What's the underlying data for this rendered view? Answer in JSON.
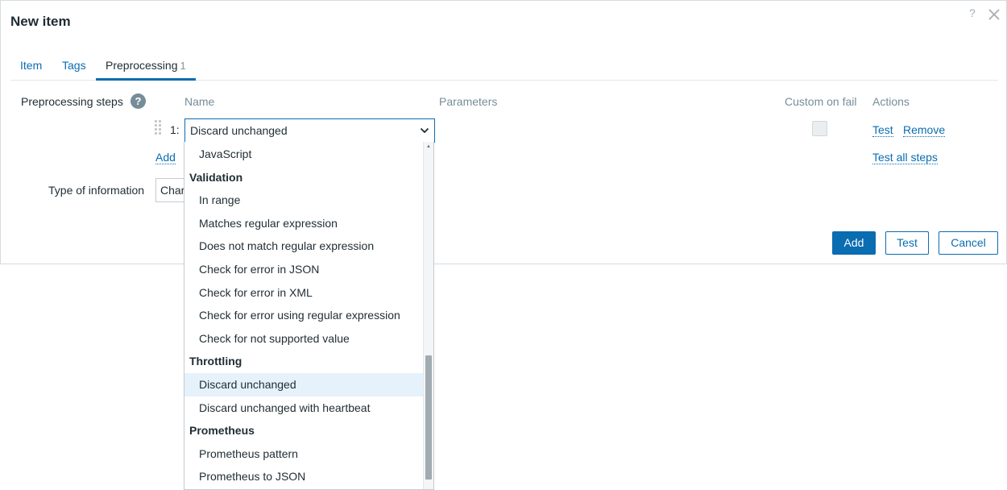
{
  "dialog": {
    "title": "New item",
    "help": "?",
    "tabs": [
      {
        "label": "Item"
      },
      {
        "label": "Tags"
      },
      {
        "label": "Preprocessing",
        "count": "1"
      }
    ]
  },
  "preprocessing": {
    "label": "Preprocessing steps",
    "help": "?",
    "columns": {
      "name": "Name",
      "parameters": "Parameters",
      "custom_on_fail": "Custom on fail",
      "actions": "Actions"
    },
    "step": {
      "number": "1:",
      "selected": "Discard unchanged",
      "custom_on_fail": false
    },
    "actions": {
      "test": "Test",
      "remove": "Remove",
      "test_all": "Test all steps",
      "add": "Add"
    }
  },
  "type_of_information": {
    "label": "Type of information",
    "value": "Character"
  },
  "buttons": {
    "add": "Add",
    "test": "Test",
    "cancel": "Cancel"
  },
  "dropdown": {
    "rows": [
      {
        "kind": "option",
        "label": "JavaScript"
      },
      {
        "kind": "group",
        "label": "Validation"
      },
      {
        "kind": "option",
        "label": "In range"
      },
      {
        "kind": "option",
        "label": "Matches regular expression"
      },
      {
        "kind": "option",
        "label": "Does not match regular expression"
      },
      {
        "kind": "option",
        "label": "Check for error in JSON"
      },
      {
        "kind": "option",
        "label": "Check for error in XML"
      },
      {
        "kind": "option",
        "label": "Check for error using regular expression"
      },
      {
        "kind": "option",
        "label": "Check for not supported value"
      },
      {
        "kind": "group",
        "label": "Throttling"
      },
      {
        "kind": "option",
        "label": "Discard unchanged",
        "selected": true
      },
      {
        "kind": "option",
        "label": "Discard unchanged with heartbeat"
      },
      {
        "kind": "group",
        "label": "Prometheus"
      },
      {
        "kind": "option",
        "label": "Prometheus pattern"
      },
      {
        "kind": "option",
        "label": "Prometheus to JSON"
      }
    ]
  },
  "colors": {
    "accent": "#0a6cb1",
    "selected_bg": "#e5f2fc",
    "muted": "#768d99"
  }
}
